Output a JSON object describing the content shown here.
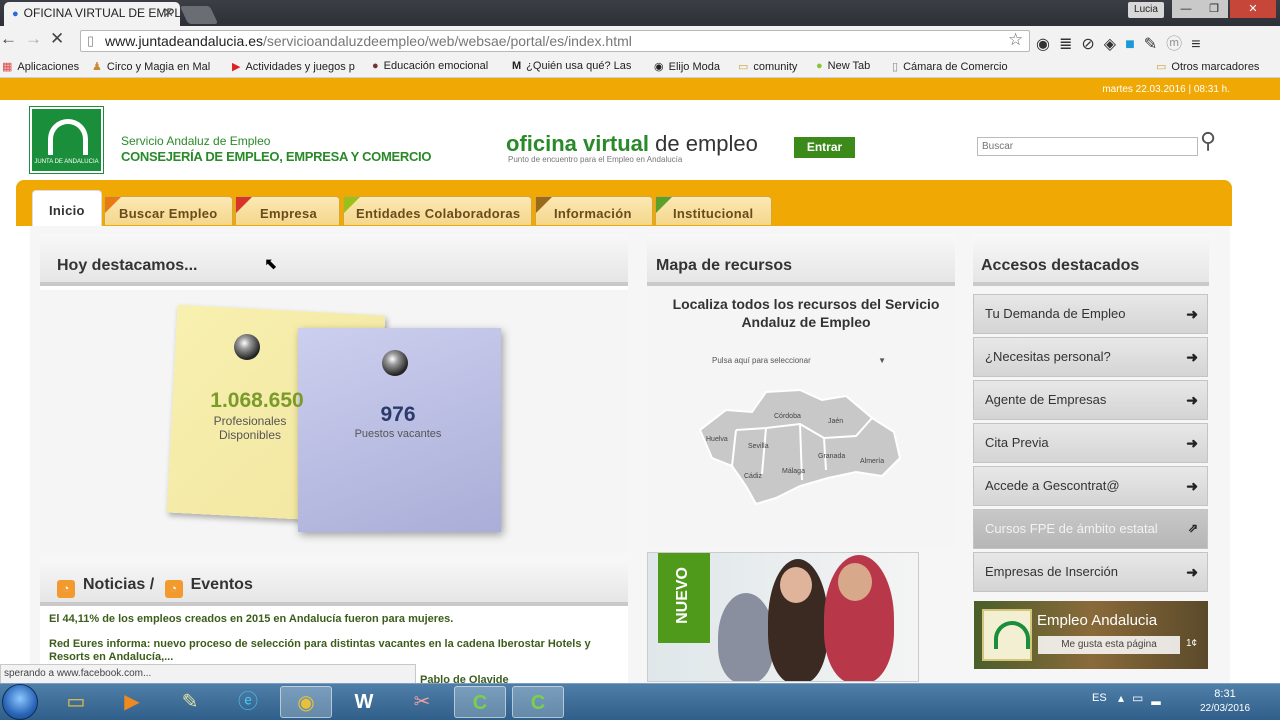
{
  "browser": {
    "tab_title": "OFICINA VIRTUAL DE EMPLE",
    "user_badge": "Lucia",
    "url_domain": "www.juntadeandalucia.es",
    "url_path": "/servicioandaluzdeempleo/web/websae/portal/es/index.html",
    "bookmarks": [
      {
        "label": "Aplicaciones"
      },
      {
        "label": "Circo y Magia en Mal"
      },
      {
        "label": "Actividades y juegos p"
      },
      {
        "label": "Educación emocional"
      },
      {
        "label": "¿Quién usa qué? Las"
      },
      {
        "label": "Elijo Moda"
      },
      {
        "label": "comunity"
      },
      {
        "label": "New Tab"
      },
      {
        "label": "Cámara de Comercio"
      }
    ],
    "other_bookmarks": "Otros marcadores",
    "status_text": "sperando a www.facebook.com..."
  },
  "header": {
    "date": "martes 22.03.2016 | 08:31 h.",
    "logo_text": "JUNTA DE ANDALUCIA",
    "org_line1": "Servicio Andaluz de Empleo",
    "org_line2": "CONSEJERÍA DE EMPLEO, EMPRESA Y COMERCIO",
    "title_green": "oficina virtual",
    "title_dark": " de empleo",
    "subtitle": "Punto de encuentro para el Empleo en Andalucía",
    "enter_label": "Entrar",
    "search_placeholder": "Buscar"
  },
  "nav": {
    "tabs": [
      {
        "label": "Inicio"
      },
      {
        "label": "Buscar Empleo",
        "color": "#e87a14"
      },
      {
        "label": "Empresa",
        "color": "#d9342a"
      },
      {
        "label": "Entidades Colaboradoras",
        "color": "#9bc01a"
      },
      {
        "label": "Información",
        "color": "#9a6a1a"
      },
      {
        "label": "Institucional",
        "color": "#5aa02a"
      }
    ]
  },
  "destacamos": {
    "title": "Hoy destacamos...",
    "stat1": {
      "value": "1.068.650",
      "label": "Profesionales Disponibles"
    },
    "stat2": {
      "value": "976",
      "label": "Puestos vacantes"
    }
  },
  "noticias": {
    "title_a": "Noticias /",
    "title_b": "Eventos",
    "items": [
      "El 44,11% de los empleos creados en 2015 en Andalucía fueron para mujeres.",
      "Red Eures informa: nuevo proceso de selección para distintas vacantes en la cadena Iberostar Hotels y Resorts en Andalucía,..."
    ],
    "partial_item": "Pablo de Olavide"
  },
  "mapa": {
    "title": "Mapa de recursos",
    "heading": "Localiza todos los recursos del Servicio Andaluz de Empleo",
    "select_placeholder": "Pulsa aquí para seleccionar",
    "provinces": [
      "Córdoba",
      "Jaén",
      "Huelva",
      "Sevilla",
      "Granada",
      "Almería",
      "Málaga",
      "Cádiz"
    ],
    "banner_label": "NUEVO"
  },
  "accesos": {
    "title": "Accesos destacados",
    "items": [
      {
        "label": "Tu Demanda de Empleo"
      },
      {
        "label": "¿Necesitas personal?"
      },
      {
        "label": "Agente de Empresas"
      },
      {
        "label": "Cita Previa"
      },
      {
        "label": "Accede a Gescontrat@"
      },
      {
        "label": "Cursos FPE de ámbito estatal"
      },
      {
        "label": "Empresas de Inserción"
      }
    ],
    "social_title": "Empleo Andalucia",
    "social_like": "Me gusta esta página",
    "social_count": "1¢"
  },
  "taskbar": {
    "lang": "ES",
    "time": "8:31",
    "date": "22/03/2016"
  },
  "colors": {
    "brand_green": "#2a8a2a",
    "orange_band": "#f0a804"
  }
}
